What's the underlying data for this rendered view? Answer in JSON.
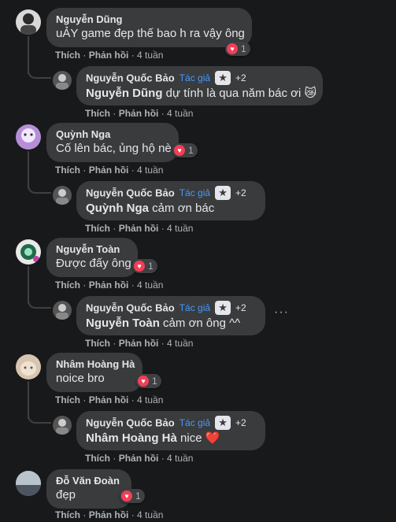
{
  "actions": {
    "like": "Thích",
    "reply": "Phản hồi",
    "time": "4 tuần",
    "dot": "·"
  },
  "author_badge": "Tác giả",
  "plus_count": "+2",
  "comments": [
    {
      "author": "Nguyễn Dũng",
      "text": "uẢY game đẹp thế bao h ra vậy ông",
      "reaction_count": "1",
      "reply": {
        "author": "Nguyễn Quốc Bảo",
        "mention": "Nguyễn Dũng",
        "text": " dự tính là qua năm bác ơi 😿"
      }
    },
    {
      "author": "Quỳnh Nga",
      "text": "Cố lên bác, ủng hộ nè",
      "reaction_count": "1",
      "reply": {
        "author": "Nguyễn Quốc Bảo",
        "mention": "Quỳnh Nga",
        "text": " cảm ơn bác"
      }
    },
    {
      "author": "Nguyễn Toàn",
      "text": "Được đấy ông",
      "reaction_count": "1",
      "reply": {
        "author": "Nguyễn Quốc Bảo",
        "mention": "Nguyễn Toàn",
        "text": " cảm ơn ông ^^",
        "more": "···"
      }
    },
    {
      "author": "Nhâm Hoàng Hà",
      "text": "noice bro",
      "reaction_count": "1",
      "reply": {
        "author": "Nguyễn Quốc Bảo",
        "mention": "Nhâm Hoàng Hà",
        "text": " nice ❤️"
      }
    },
    {
      "author": "Đỗ Văn Đoàn",
      "text": "đẹp",
      "reaction_count": "1"
    }
  ],
  "icons": {
    "reaction": "heart-icon",
    "star": "star-icon",
    "more": "more-options-icon"
  },
  "colors": {
    "background": "#18191a",
    "bubble": "#3a3b3c",
    "badge": "#4599ff",
    "heart": "#f33e58"
  }
}
